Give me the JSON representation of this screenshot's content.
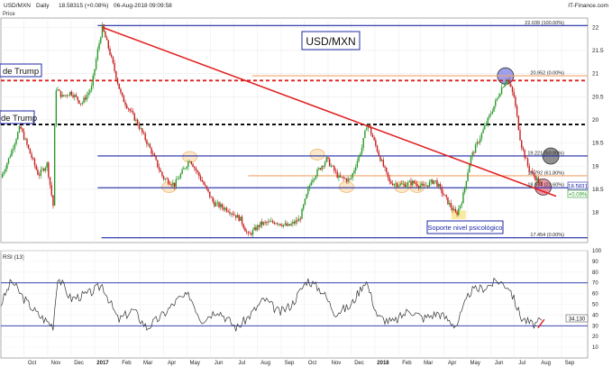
{
  "header": {
    "title": "USD/MXN",
    "timeframe": "Daily",
    "quote": "18.58315 (+0.08%)",
    "datetime": "06-Aug-2018 09:09:58",
    "brand": "IT-Finance.com",
    "price_label": "Price"
  },
  "chart_data": [
    {
      "type": "candlestick",
      "title": "USD/MXN",
      "ylim": [
        17.35,
        22.2
      ],
      "xlim": [
        "2016-09-01",
        "2018-10-05"
      ],
      "x_ticks": [
        "Oct",
        "Nov",
        "Dec",
        "2017",
        "Feb",
        "Mar",
        "Apr",
        "May",
        "Jun",
        "Jul",
        "Aug",
        "Sep",
        "Oct",
        "Nov",
        "Dec",
        "2018",
        "Feb",
        "Mar",
        "Apr",
        "May",
        "Jun",
        "Jul",
        "Aug",
        "Sep"
      ],
      "y_ticks": [
        18,
        18.5,
        19,
        19.5,
        20,
        20.5,
        21,
        21.5,
        22
      ],
      "series": {
        "close_path": [
          [
            "2016-09-01",
            18.75
          ],
          [
            "2016-09-12",
            19.2
          ],
          [
            "2016-09-26",
            19.85
          ],
          [
            "2016-10-05",
            19.45
          ],
          [
            "2016-10-20",
            18.8
          ],
          [
            "2016-10-31",
            19.05
          ],
          [
            "2016-11-08",
            18.15
          ],
          [
            "2016-11-11",
            20.7
          ],
          [
            "2016-11-20",
            20.5
          ],
          [
            "2016-12-01",
            20.6
          ],
          [
            "2016-12-15",
            20.35
          ],
          [
            "2016-12-28",
            20.7
          ],
          [
            "2017-01-05",
            21.5
          ],
          [
            "2017-01-11",
            22.0
          ],
          [
            "2017-01-20",
            21.5
          ],
          [
            "2017-02-05",
            20.5
          ],
          [
            "2017-02-25",
            19.95
          ],
          [
            "2017-03-15",
            19.35
          ],
          [
            "2017-03-31",
            18.75
          ],
          [
            "2017-04-15",
            18.6
          ],
          [
            "2017-05-05",
            19.15
          ],
          [
            "2017-05-20",
            18.7
          ],
          [
            "2017-06-05",
            18.2
          ],
          [
            "2017-06-25",
            18.05
          ],
          [
            "2017-07-10",
            17.85
          ],
          [
            "2017-07-20",
            17.5
          ],
          [
            "2017-08-05",
            17.75
          ],
          [
            "2017-08-25",
            17.8
          ],
          [
            "2017-09-10",
            17.7
          ],
          [
            "2017-09-25",
            17.85
          ],
          [
            "2017-10-10",
            18.7
          ],
          [
            "2017-10-30",
            19.15
          ],
          [
            "2017-11-15",
            18.75
          ],
          [
            "2017-11-30",
            18.7
          ],
          [
            "2017-12-15",
            19.4
          ],
          [
            "2017-12-22",
            19.95
          ],
          [
            "2018-01-05",
            19.3
          ],
          [
            "2018-01-20",
            18.65
          ],
          [
            "2018-02-05",
            18.6
          ],
          [
            "2018-02-20",
            18.65
          ],
          [
            "2018-03-05",
            18.55
          ],
          [
            "2018-03-20",
            18.7
          ],
          [
            "2018-04-05",
            18.25
          ],
          [
            "2018-04-17",
            17.95
          ],
          [
            "2018-04-25",
            18.3
          ],
          [
            "2018-05-05",
            19.15
          ],
          [
            "2018-05-20",
            19.7
          ],
          [
            "2018-06-05",
            20.3
          ],
          [
            "2018-06-15",
            20.7
          ],
          [
            "2018-06-22",
            20.9
          ],
          [
            "2018-07-01",
            20.5
          ],
          [
            "2018-07-10",
            19.5
          ],
          [
            "2018-07-20",
            18.95
          ],
          [
            "2018-08-06",
            18.58
          ]
        ],
        "last_price": 18.5831,
        "last_change": "+0.09%"
      },
      "horizontal_levels": [
        {
          "value": 22.039,
          "label": "22.039 (100.00%)",
          "color": "#1f2aa6",
          "style": "solid"
        },
        {
          "value": 20.952,
          "label": "20.952 (0.00%)",
          "color": "#f4a46a",
          "style": "solid"
        },
        {
          "value": 20.85,
          "color": "#e02020",
          "style": "dashed"
        },
        {
          "value": 19.9,
          "color": "#000000",
          "style": "dashed"
        },
        {
          "value": 19.221,
          "label": "19.221 (50.00%)",
          "color": "#1f2aa6",
          "style": "solid"
        },
        {
          "value": 18.792,
          "label": "18.792 (61.80%)",
          "color": "#f4a46a",
          "style": "solid"
        },
        {
          "value": 18.534,
          "label": "18.534 (23.60%)",
          "color": "#1f2aa6",
          "style": "solid"
        },
        {
          "value": 17.454,
          "label": "17.454 (0.00%)",
          "color": "#1f2aa6",
          "style": "solid"
        }
      ],
      "trendline": {
        "start": [
          "2017-01-11",
          22.0
        ],
        "end": [
          "2018-08-25",
          18.35
        ],
        "color": "#e02020"
      },
      "annotations": {
        "trump_label_1": "de Trump",
        "trump_label_2": "de Trump",
        "support_label": "Soporte nivel psicológico",
        "price_badge": "18.5831",
        "change_badge": "+0.09%"
      },
      "markers": [
        {
          "date": "2017-04-08",
          "value": 18.55,
          "shape": "oval",
          "color": "#f4a46a"
        },
        {
          "date": "2017-05-05",
          "value": 19.2,
          "shape": "oval",
          "color": "#f4a46a"
        },
        {
          "date": "2017-10-18",
          "value": 19.25,
          "shape": "oval",
          "color": "#f4a46a"
        },
        {
          "date": "2017-11-25",
          "value": 18.55,
          "shape": "oval",
          "color": "#f4a46a"
        },
        {
          "date": "2018-02-05",
          "value": 18.55,
          "shape": "oval",
          "color": "#f4a46a"
        },
        {
          "date": "2018-02-25",
          "value": 18.55,
          "shape": "oval",
          "color": "#f4a46a"
        },
        {
          "date": "2018-06-20",
          "value": 20.95,
          "shape": "circle",
          "color": "#6b6be0"
        },
        {
          "date": "2018-08-18",
          "value": 19.22,
          "shape": "circle",
          "color": "#555555"
        },
        {
          "date": "2018-08-08",
          "value": 18.55,
          "shape": "circle",
          "color": "#e05a7a"
        },
        {
          "date": "2018-04-20",
          "value": 17.95,
          "shape": "rect",
          "color": "#f7e48a"
        }
      ]
    },
    {
      "type": "line",
      "title": "RSI (13)",
      "ylim": [
        0,
        100
      ],
      "y_ticks": [
        10,
        20,
        30,
        40,
        50,
        60,
        70,
        80,
        90,
        100
      ],
      "levels": [
        70,
        30
      ],
      "last_value": "34.130",
      "values": [
        [
          "2016-09-01",
          50
        ],
        [
          "2016-09-15",
          72
        ],
        [
          "2016-10-01",
          55
        ],
        [
          "2016-10-20",
          40
        ],
        [
          "2016-11-08",
          30
        ],
        [
          "2016-11-14",
          76
        ],
        [
          "2016-12-01",
          55
        ],
        [
          "2016-12-25",
          60
        ],
        [
          "2017-01-11",
          68
        ],
        [
          "2017-02-01",
          35
        ],
        [
          "2017-02-20",
          45
        ],
        [
          "2017-03-10",
          28
        ],
        [
          "2017-03-31",
          40
        ],
        [
          "2017-04-20",
          55
        ],
        [
          "2017-05-05",
          58
        ],
        [
          "2017-05-20",
          35
        ],
        [
          "2017-06-10",
          45
        ],
        [
          "2017-07-05",
          28
        ],
        [
          "2017-07-20",
          38
        ],
        [
          "2017-08-10",
          55
        ],
        [
          "2017-08-30",
          42
        ],
        [
          "2017-09-15",
          50
        ],
        [
          "2017-10-05",
          73
        ],
        [
          "2017-10-25",
          62
        ],
        [
          "2017-11-10",
          42
        ],
        [
          "2017-11-30",
          48
        ],
        [
          "2017-12-20",
          73
        ],
        [
          "2018-01-05",
          38
        ],
        [
          "2018-01-25",
          33
        ],
        [
          "2018-02-15",
          45
        ],
        [
          "2018-03-05",
          37
        ],
        [
          "2018-03-25",
          42
        ],
        [
          "2018-04-17",
          30
        ],
        [
          "2018-05-05",
          62
        ],
        [
          "2018-05-25",
          66
        ],
        [
          "2018-06-10",
          72
        ],
        [
          "2018-06-25",
          66
        ],
        [
          "2018-07-10",
          38
        ],
        [
          "2018-07-25",
          31
        ],
        [
          "2018-08-06",
          34
        ]
      ]
    }
  ]
}
